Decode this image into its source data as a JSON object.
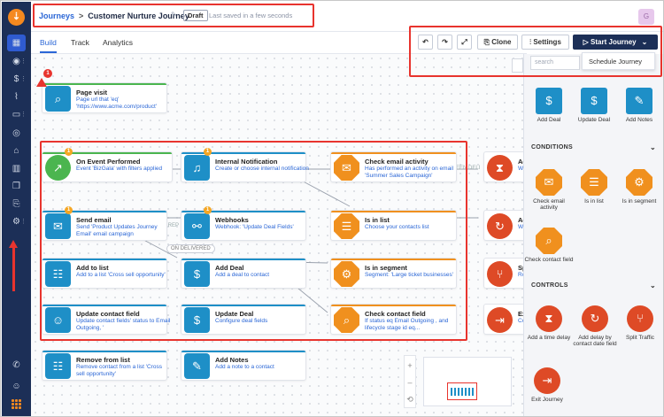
{
  "header": {
    "breadcrumb_root": "Journeys",
    "separator": ">",
    "journey_name": "Customer Nurture Journey",
    "status": "Draft",
    "saved_text": "Last saved in a few seconds",
    "avatar_initial": "G"
  },
  "tabs": [
    {
      "label": "Build",
      "active": true
    },
    {
      "label": "Track",
      "active": false
    },
    {
      "label": "Analytics",
      "active": false
    }
  ],
  "toolbar": {
    "undo": "↶",
    "redo": "↷",
    "expand": "⤢",
    "clone": "Clone",
    "settings": "Settings",
    "start": "Start Journey",
    "start_caret": "⌄",
    "dropdown_item": "Schedule Journey"
  },
  "panel": {
    "search_placeholder": "search",
    "collapse_glyph": "›",
    "top_items": [
      "Add Deal",
      "Update Deal",
      "Add Notes"
    ],
    "conditions_title": "CONDITIONS",
    "conditions": [
      "Check email activity",
      "Is in list",
      "Is in segment",
      "Check contact field"
    ],
    "controls_title": "CONTROLS",
    "controls": [
      "Add a time delay",
      "Add delay by contact date field",
      "Split Traffic",
      "Exit Journey"
    ]
  },
  "nodes": {
    "page_visit": {
      "title": "Page visit",
      "desc": "Page url that 'eq' 'https://www.acme.com/product'"
    },
    "on_event": {
      "title": "On Event Performed",
      "desc": "Event 'BizGala' with filters applied"
    },
    "internal_notif": {
      "title": "Internal Notification",
      "desc": "Create or choose internal notification"
    },
    "check_email": {
      "title": "Check email activity",
      "desc": "Has performed an activity on email 'Summer Sales Campaign'"
    },
    "send_email": {
      "title": "Send email",
      "desc": "Send 'Product Updates Journey Email' email campaign"
    },
    "webhooks": {
      "title": "Webhooks",
      "desc": "Webhook: 'Update Deal Fields'"
    },
    "is_in_list": {
      "title": "Is in list",
      "desc": "Choose your contacts list"
    },
    "add_to_list": {
      "title": "Add to list",
      "desc": "Add to a list 'Cross sell opportunity'"
    },
    "add_deal": {
      "title": "Add Deal",
      "desc": "Add a deal to contact"
    },
    "is_in_segment": {
      "title": "Is in segment",
      "desc": "Segment: 'Large ticket businesses'"
    },
    "update_contact": {
      "title": "Update contact field",
      "desc": "Update contact fields' status to Email Outgoing, '"
    },
    "update_deal": {
      "title": "Update Deal",
      "desc": "Configure deal fields"
    },
    "check_contact": {
      "title": "Check contact field",
      "desc": "If status eq Email Outgoing , and lifecycle stage id eq..."
    },
    "remove_list": {
      "title": "Remove from list",
      "desc": "Remove contact from a list 'Cross sell opportunity'"
    },
    "add_notes": {
      "title": "Add Notes",
      "desc": "Add a note to a contact"
    }
  },
  "partial_nodes": {
    "a1_title": "Ad",
    "a1_desc": "Wa ON",
    "a2_title": "Ad",
    "a2_desc": "We cor",
    "a3_title": "Sp",
    "a3_desc": "Rou",
    "a4_title": "Exi",
    "a4_desc": "Co rea"
  },
  "edge_labels": {
    "on_delivered": "ON DELIVERED",
    "on_rep": "ON REP",
    "een_deli": "EEN DELI"
  },
  "badges": {
    "step": "1",
    "alert": "1"
  },
  "zoom": {
    "plus": "+",
    "minus": "–",
    "reset": "⟲"
  },
  "colors": {
    "accent": "#2a66d6",
    "navy": "#1c2f57",
    "orange": "#f0901e",
    "green": "#4bb54f",
    "blue": "#1e8fc7",
    "red": "#de4a26",
    "annotation": "#e8342e"
  },
  "icons": {
    "rail": [
      "logo-icon",
      "calendar-icon",
      "contacts-icon",
      "deals-icon",
      "reports-icon",
      "chat-icon",
      "target-icon",
      "campaign-icon",
      "analytics-icon",
      "box-icon",
      "journey-icon",
      "settings-icon",
      "phone-icon",
      "help-icon",
      "apps-grid-icon"
    ]
  }
}
